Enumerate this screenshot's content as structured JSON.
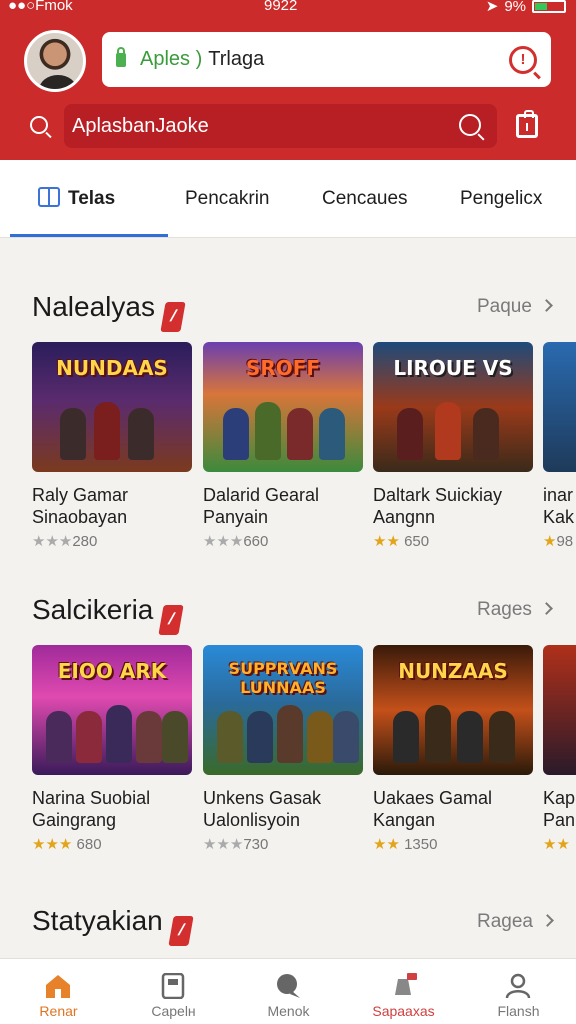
{
  "statusbar": {
    "carrier": "●●○Fmok",
    "time": "9922",
    "battery": "9%",
    "battery_level": 0.4
  },
  "header": {
    "app_field": {
      "part1": "Aples )",
      "part2": "Trlaga"
    },
    "search": {
      "value": "AplasbanJaoke"
    }
  },
  "tabs": [
    {
      "label": "Telas",
      "active": true
    },
    {
      "label": "Pencakrin"
    },
    {
      "label": "Cencaues"
    },
    {
      "label": "Pengelicx"
    }
  ],
  "sections": [
    {
      "title": "Nalealyas",
      "link": "Paque",
      "cards": [
        {
          "banner": "NUNDAAS",
          "name": "Raly Gamar",
          "sub": "Sinaobayan",
          "stars": "★★★",
          "rating": "280",
          "gold": false
        },
        {
          "banner": "SROFF",
          "name": "Dalarid Gearal",
          "sub": "Panyain",
          "stars": "★★★",
          "rating": "660",
          "gold": false
        },
        {
          "banner": "LIROUE VS",
          "name": "Daltark Suickiay",
          "sub": "Aangnn",
          "stars": "★★",
          "rating": "650",
          "gold": true
        },
        {
          "banner": "",
          "name": "inar",
          "sub": "Kak",
          "stars": "★",
          "rating": "98",
          "gold": true
        }
      ]
    },
    {
      "title": "Salcikeria",
      "link": "Rages",
      "cards": [
        {
          "banner": "ЕІОО ARK",
          "name": "Narina Suobial",
          "sub": "Gaingrang",
          "stars": "★★★",
          "rating": "680",
          "gold": true
        },
        {
          "banner": "SUPPRVANS LUNNAAS",
          "name": "Unkens Gasak",
          "sub": "Ualonlisyoin",
          "stars": "★★★",
          "rating": "730",
          "gold": false
        },
        {
          "banner": "NUNZAAS",
          "name": "Uakaes Gamal",
          "sub": "Kangan",
          "stars": "★★",
          "rating": "1350",
          "gold": true
        },
        {
          "banner": "",
          "name": "Kap",
          "sub": "Pan",
          "stars": "★★",
          "rating": "",
          "gold": true
        }
      ]
    },
    {
      "title": "Statyakian",
      "link": "Ragea"
    }
  ],
  "bottom_nav": [
    {
      "label": "Renar",
      "icon": "home-icon",
      "active": true
    },
    {
      "label": "Capelн",
      "icon": "notebook-icon"
    },
    {
      "label": "Menok",
      "icon": "chat-icon"
    },
    {
      "label": "Sapaaxas",
      "icon": "sale-bell-icon"
    },
    {
      "label": "Flansh",
      "icon": "profile-icon"
    }
  ]
}
